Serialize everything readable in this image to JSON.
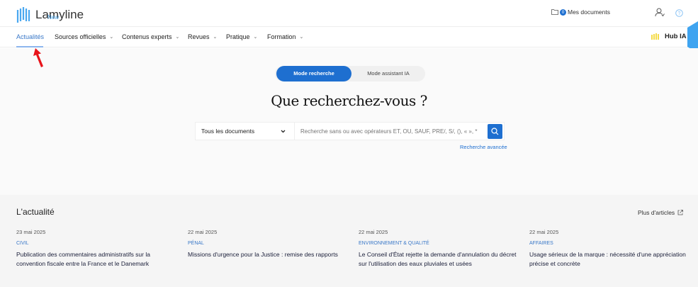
{
  "header": {
    "logo_text": "Lamyline",
    "logo_badge": "New",
    "documents_count": "0",
    "documents_label": "Mes documents"
  },
  "nav": {
    "items": [
      {
        "label": "Actualités",
        "active": true
      },
      {
        "label": "Sources officielles"
      },
      {
        "label": "Contenus experts"
      },
      {
        "label": "Revues"
      },
      {
        "label": "Pratique"
      },
      {
        "label": "Formation"
      }
    ],
    "hub_label": "Hub IA"
  },
  "hero": {
    "mode_search": "Mode recherche",
    "mode_ai": "Mode assistant IA",
    "title": "Que recherchez-vous ?",
    "select_value": "Tous les documents",
    "search_placeholder": "Recherche sans ou avec opérateurs ET, OU, SAUF, PRE/, S/, (), « », *",
    "advanced_link": "Recherche avancée"
  },
  "news": {
    "title": "L'actualité",
    "more_label": "Plus d'articles",
    "articles": [
      {
        "date": "23 mai 2025",
        "category": "CIVIL",
        "headline": "Publication des commentaires administratifs sur la convention fiscale entre la France et le Danemark"
      },
      {
        "date": "22 mai 2025",
        "category": "PÉNAL",
        "headline": "Missions d'urgence pour la Justice : remise des rapports"
      },
      {
        "date": "22 mai 2025",
        "category": "ENVIRONNEMENT & QUALITÉ",
        "headline": "Le Conseil d'État rejette la demande d'annulation du décret sur l'utilisation des eaux pluviales et usées"
      },
      {
        "date": "22 mai 2025",
        "category": "AFFAIRES",
        "headline": "Usage sérieux de la marque : nécessité d'une appréciation précise et concrète"
      }
    ]
  },
  "colors": {
    "primary": "#1e6fd0",
    "accent": "#3fa4f0",
    "annotation_arrow": "#e8141b"
  }
}
